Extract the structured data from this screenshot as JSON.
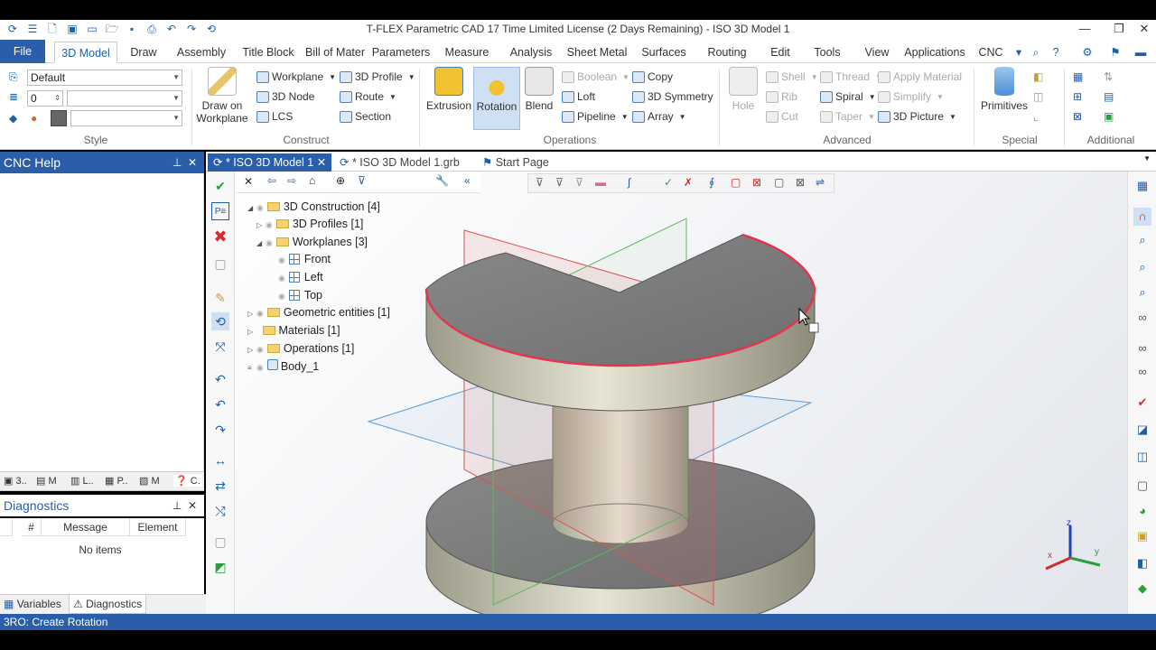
{
  "window": {
    "title": "T-FLEX Parametric CAD 17 Time Limited License (2 Days Remaining) - ISO 3D Model 1"
  },
  "ribbon_tabs": [
    "File",
    "3D Model",
    "Draw",
    "Assembly",
    "Title Block",
    "Bill of Mater",
    "Parameters",
    "Measure",
    "Analysis",
    "Sheet Metal",
    "Surfaces",
    "Routing",
    "Edit",
    "Tools",
    "View",
    "Applications",
    "CNC"
  ],
  "style_group": {
    "label": "Style",
    "style_value": "Default",
    "level_value": "0"
  },
  "construct_group": {
    "label": "Construct",
    "draw_on_workplane": "Draw on Workplane",
    "items": [
      "Workplane",
      "3D Node",
      "LCS",
      "3D Profile",
      "Route",
      "Section"
    ]
  },
  "operations_group": {
    "label": "Operations",
    "extrusion": "Extrusion",
    "rotation": "Rotation",
    "blend": "Blend",
    "items": [
      "Boolean",
      "Loft",
      "Pipeline",
      "Copy",
      "3D Symmetry",
      "Array"
    ]
  },
  "advanced_group": {
    "label": "Advanced",
    "hole": "Hole",
    "items": [
      "Shell",
      "Rib",
      "Cut",
      "Thread",
      "Spiral",
      "Taper",
      "Apply Material",
      "Simplify",
      "3D Picture"
    ]
  },
  "special_group": {
    "label": "Special",
    "primitives": "Primitives"
  },
  "additional_group": {
    "label": "Additional"
  },
  "left_panel": {
    "title": "CNC Help",
    "tabs": [
      "3..",
      "M",
      "L..",
      "P..",
      "M",
      "C."
    ]
  },
  "diagnostics": {
    "title": "Diagnostics",
    "columns": [
      "#",
      "Message",
      "Element"
    ],
    "empty": "No items"
  },
  "bottom_tabs": [
    "Variables",
    "Diagnostics"
  ],
  "doc_tabs": [
    "* ISO 3D Model 1",
    "* ISO 3D Model 1.grb",
    "Start Page"
  ],
  "tree": {
    "root": "3D Construction [4]",
    "profiles": "3D Profiles [1]",
    "workplanes": "Workplanes [3]",
    "front": "Front",
    "left": "Left",
    "top": "Top",
    "geometric": "Geometric entities [1]",
    "materials": "Materials [1]",
    "operations": "Operations [1]",
    "body": "Body_1"
  },
  "status": {
    "text": "3RO: Create Rotation"
  },
  "triad": {
    "x": "x",
    "y": "y",
    "z": "z"
  },
  "colors": {
    "accent": "#2a5ea8",
    "selection_edge": "#e0364f",
    "workplane_front": "#d9534f",
    "workplane_left": "#5cb85c",
    "workplane_top": "#5b9bd5"
  }
}
